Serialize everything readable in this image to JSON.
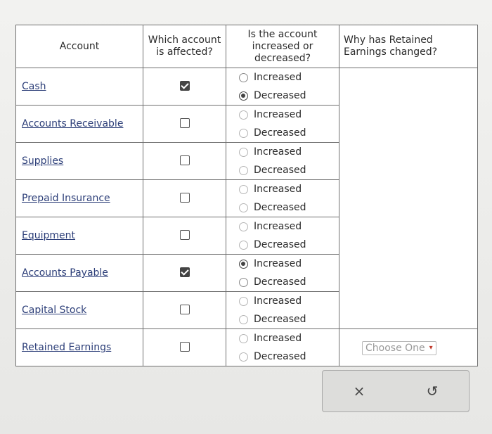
{
  "headers": {
    "account": "Account",
    "affected": "Which account is affected?",
    "change": "Is the account increased or decreased?",
    "why": "Why has Retained Earnings changed?"
  },
  "rows": [
    {
      "account": "Cash",
      "checked": true,
      "opt1": "Increased",
      "opt2": "Decreased",
      "selected": "Decreased"
    },
    {
      "account": "Accounts Receivable",
      "checked": false,
      "opt1": "Increased",
      "opt2": "Decreased",
      "selected": ""
    },
    {
      "account": "Supplies",
      "checked": false,
      "opt1": "Increased",
      "opt2": "Decreased",
      "selected": ""
    },
    {
      "account": "Prepaid Insurance",
      "checked": false,
      "opt1": "Increased",
      "opt2": "Decreased",
      "selected": ""
    },
    {
      "account": "Equipment",
      "checked": false,
      "opt1": "Increased",
      "opt2": "Decreased",
      "selected": ""
    },
    {
      "account": "Accounts Payable",
      "checked": true,
      "opt1": "Increased",
      "opt2": "Decreased",
      "selected": "Increased"
    },
    {
      "account": "Capital Stock",
      "checked": false,
      "opt1": "Increased",
      "opt2": "Decreased",
      "selected": ""
    },
    {
      "account": "Retained Earnings",
      "checked": false,
      "opt1": "Increased",
      "opt2": "Decreased",
      "selected": ""
    }
  ],
  "why_select": {
    "value": "Choose One"
  },
  "actions": {
    "clear_icon": "close-icon",
    "reset_icon": "undo-icon",
    "clear_glyph": "×",
    "reset_glyph": "↺"
  }
}
